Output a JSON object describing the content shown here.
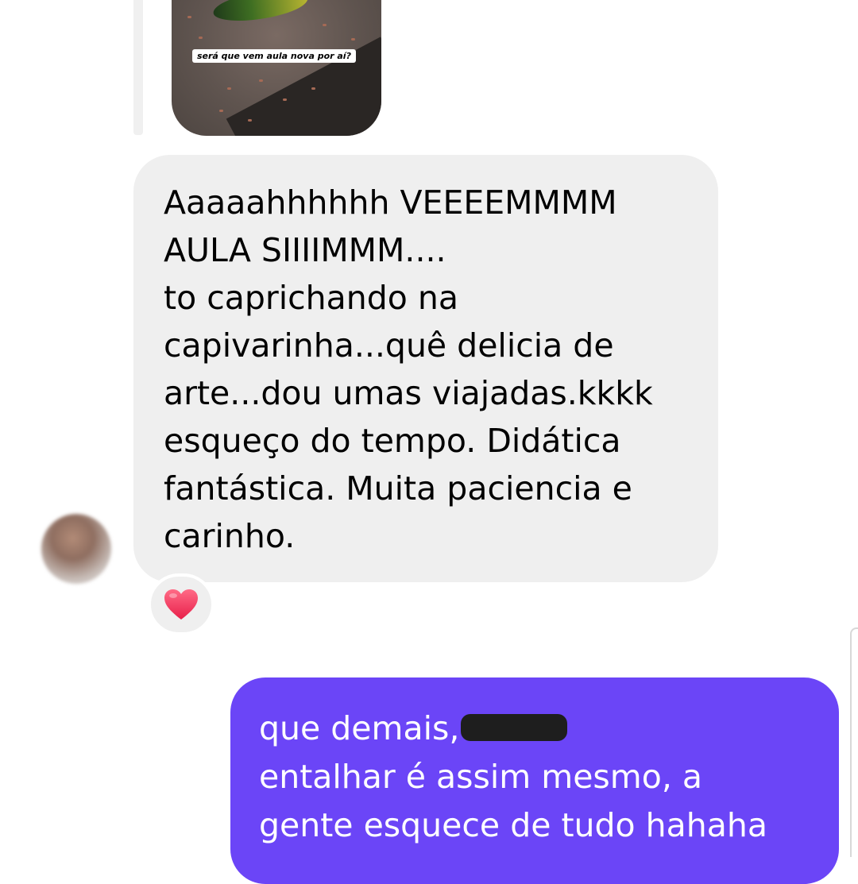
{
  "thread": {
    "story_reply": {
      "caption": "será que vem aula nova por aí?"
    },
    "incoming_message": {
      "text": "Aaaaahhhhhh VEEEEMMMM\nAULA SIIIIMMM....\nto caprichando na\ncapivarinha...quê delicia de\narte...dou umas viajadas.kkkk\nesqueço do tempo. Didática\nfantástica. Muita paciencia e\ncarinho.",
      "reaction_icon": "heart-icon"
    },
    "outgoing_message": {
      "line1": "que demais,",
      "line2": "entalhar é assim mesmo, a",
      "line3": "gente esquece de tudo hahaha"
    }
  },
  "colors": {
    "incoming_bubble": "#efefef",
    "outgoing_bubble": "#6b45f7",
    "reaction_heart": "#f0365a"
  }
}
